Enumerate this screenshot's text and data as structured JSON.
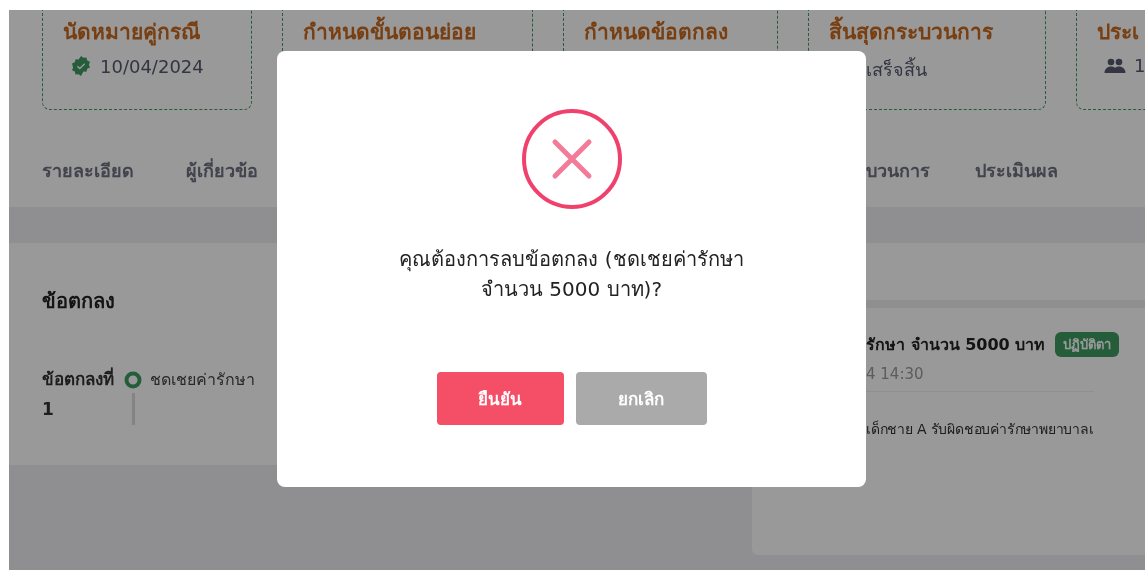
{
  "step_cards": [
    {
      "title": "นัดหมายคู่กรณี",
      "subtitle": "10/04/2024"
    },
    {
      "title": "กำหนดขั้นตอนย่อย"
    },
    {
      "title": "กำหนดข้อตกลง"
    },
    {
      "title": "สิ้นสุดกระบวนการ",
      "subtitle": "เสร็จสิ้น"
    },
    {
      "title": "ประเ",
      "subtitle": "1"
    }
  ],
  "tabs": [
    {
      "label": "รายละเอียด"
    },
    {
      "label": "ผู้เกี่ยวข้อ"
    },
    {
      "label": "บวนการ"
    },
    {
      "label": "ประเมินผล"
    }
  ],
  "agreements_panel": {
    "heading": "ข้อตกลง",
    "items": [
      {
        "label": "ข้อตกลงที่ 1",
        "text": "ชดเชยค่ารักษา"
      }
    ]
  },
  "detail_card": {
    "title": "รักษา จำนวน 5000 บาท",
    "badge": "ปฏิบัติตา",
    "time": "4 14:30",
    "body": "เด็กชาย A รับผิดชอบค่ารักษาพยาบาลเ"
  },
  "dialog": {
    "message": "คุณต้องการลบข้อตกลง (ชดเชยค่ารักษา จำนวน 5000 บาท)?",
    "buttons": [
      {
        "label": "ยืนยัน",
        "kind": "confirm"
      },
      {
        "label": "ยกเลิก",
        "kind": "cancel"
      }
    ]
  }
}
